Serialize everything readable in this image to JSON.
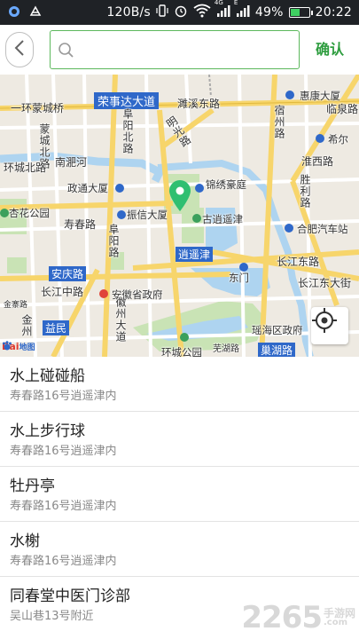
{
  "status_bar": {
    "net_speed": "120B/s",
    "network_label_1": "4G",
    "network_label_2": "E",
    "battery": "49%",
    "battery_level": 0.49,
    "time": "20:22",
    "icons": [
      "notification-icon",
      "app-icon",
      "vibrate-icon",
      "alarm-icon",
      "wifi-icon",
      "signal-icon",
      "signal-icon",
      "battery-icon"
    ]
  },
  "header": {
    "search_placeholder": "",
    "search_value": "",
    "confirm_label": "确认",
    "accent_color": "#2e9d3f"
  },
  "map": {
    "labels": {
      "ring_road": "一环蒙城桥",
      "rongshida": "荣事达大道",
      "tanhu": "濉溪东路",
      "huikang": "惠康大厦",
      "linquan": "临泉路",
      "mingguang": "明光路",
      "mengcheng": "蒙城北路",
      "fuyang": "阜阳北路",
      "suzhou": "宿州路",
      "xier": "希尔",
      "huaixi": "淮西路",
      "huancheng": "环城北路",
      "nanfei": "南淝河",
      "shengli": "胜利路",
      "zhengtong": "政通大厦",
      "jinxiu": "锦绣豪庭",
      "xinghua": "杏花公园",
      "shouchun": "寿春路",
      "zhenxin": "振信大厦",
      "gu_xiaoyao": "古逍遥津",
      "hefei_bus": "合肥汽车站",
      "fuyang2": "阜阳路",
      "xiaoyaojin": "逍遥津",
      "changjiang_e": "长江东路",
      "dongmen": "东门",
      "anqing": "安庆路",
      "changjiang_m": "长江中路",
      "province": "安徽省政府",
      "changjiang_ej": "长江东大街",
      "jinzhai": "金寨路",
      "huizhou": "徽州大道",
      "jinzhou": "金州",
      "yimin": "益民",
      "yaohai": "瑶海区政府",
      "huan_park": "环城公园",
      "wuhu": "芜湖路",
      "chaohu": "巢湖路",
      "mingguang2": "明光路"
    },
    "logo_text_1": "Bai",
    "logo_text_2": "地图",
    "colors": {
      "road_major": "#f7d56b",
      "road_minor": "#ffffff",
      "water": "#aed4f0",
      "park": "#c9e3b5",
      "label_bg": "#2f68c9",
      "pin": "#2fbf71"
    }
  },
  "results": [
    {
      "name": "水上碰碰船",
      "address": "寿春路16号逍遥津内"
    },
    {
      "name": "水上步行球",
      "address": "寿春路16号逍遥津内"
    },
    {
      "name": "牡丹亭",
      "address": "寿春路16号逍遥津内"
    },
    {
      "name": "水榭",
      "address": "寿春路16号逍遥津内"
    },
    {
      "name": "同春堂中医门诊部",
      "address": "吴山巷13号附近"
    }
  ],
  "watermark": {
    "number": "2265",
    "cn": "手游网",
    "en": ".com"
  }
}
